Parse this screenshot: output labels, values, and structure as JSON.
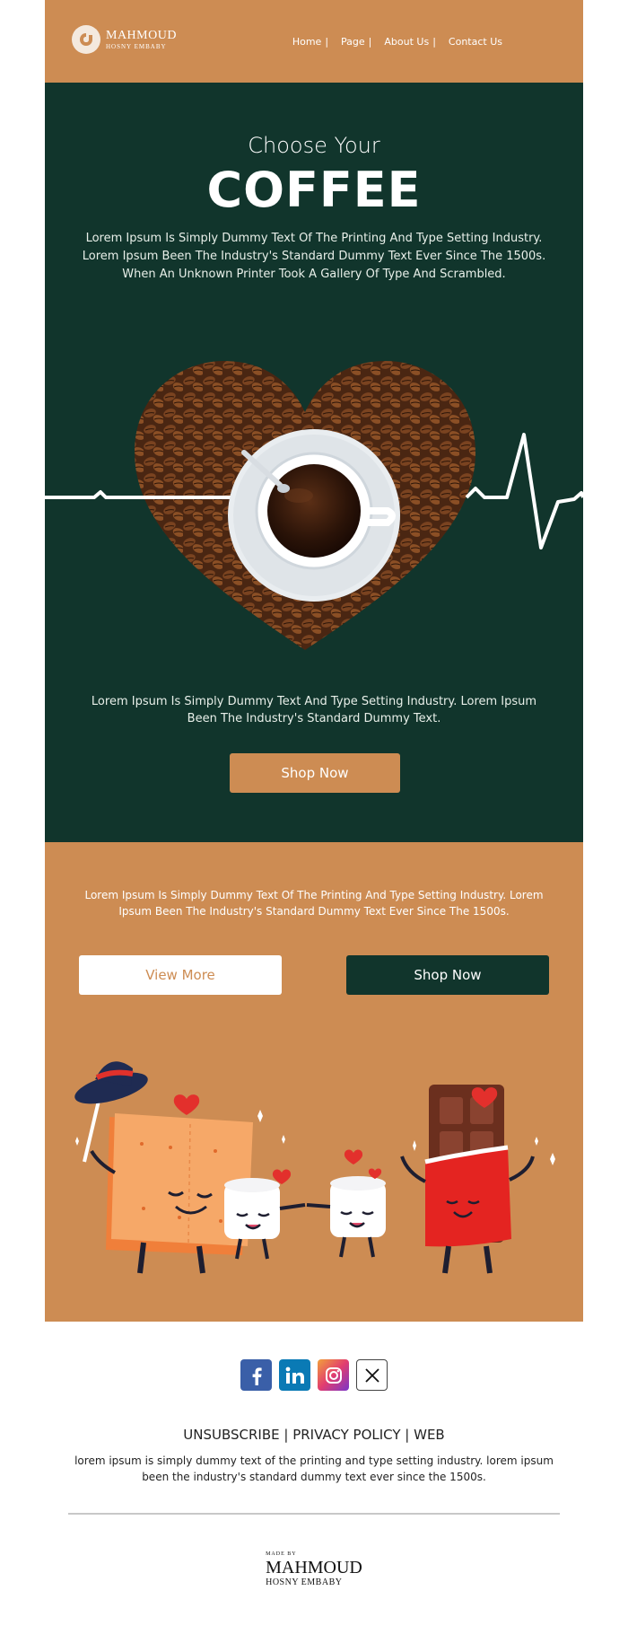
{
  "brand": {
    "name": "MAHMOUD",
    "sub": "HOSNY EMBABY"
  },
  "nav": {
    "items": [
      "Home",
      "Page",
      "About Us",
      "Contact Us"
    ],
    "separator": "|"
  },
  "hero": {
    "subtitle": "Choose Your",
    "title": "COFFEE",
    "text": "Lorem Ipsum Is Simply Dummy Text Of The Printing And Type Setting Industry. Lorem Ipsum Been The Industry's Standard Dummy Text Ever Since The 1500s. When An Unknown Printer Took A Gallery Of Type And Scrambled.",
    "text2": "Lorem Ipsum Is Simply Dummy Text And Type Setting Industry. Lorem Ipsum Been The Industry's Standard Dummy Text.",
    "button": "Shop Now"
  },
  "promo": {
    "text": "Lorem Ipsum Is Simply Dummy Text Of The Printing And Type Setting Industry. Lorem Ipsum Been The Industry's Standard Dummy Text Ever Since The 1500s.",
    "view_more": "View More",
    "shop_now": "Shop Now"
  },
  "footer": {
    "socials": [
      "facebook-icon",
      "linkedin-icon",
      "instagram-icon",
      "x-icon"
    ],
    "links": [
      "UNSUBSCRIBE",
      "PRIVACY POLICY",
      "WEB"
    ],
    "link_separator": " | ",
    "text": "lorem ipsum is simply dummy text of the printing and type setting industry. lorem ipsum been the industry's standard dummy text ever since the 1500s.",
    "made_by": "MADE BY",
    "made_name": "MAHMOUD",
    "made_sub": "HOSNY EMBABY"
  },
  "colors": {
    "orange": "#cd8c53",
    "green": "#11352c",
    "white": "#ffffff"
  }
}
